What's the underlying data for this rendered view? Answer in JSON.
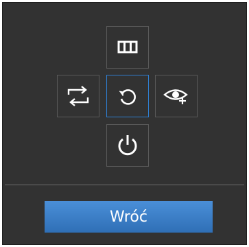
{
  "dpad": {
    "up": {
      "icon": "columns-icon"
    },
    "left": {
      "icon": "swap-arrows-icon"
    },
    "center": {
      "icon": "rotate-icon"
    },
    "right": {
      "icon": "eye-plus-icon"
    },
    "down": {
      "icon": "power-icon"
    }
  },
  "footer": {
    "back_label": "Wróć"
  },
  "colors": {
    "panel_bg": "#323232",
    "button_border": "#5a5a5a",
    "selected_border": "#2f7fd1",
    "back_button": "#3c80cc",
    "icon": "#ffffff"
  }
}
